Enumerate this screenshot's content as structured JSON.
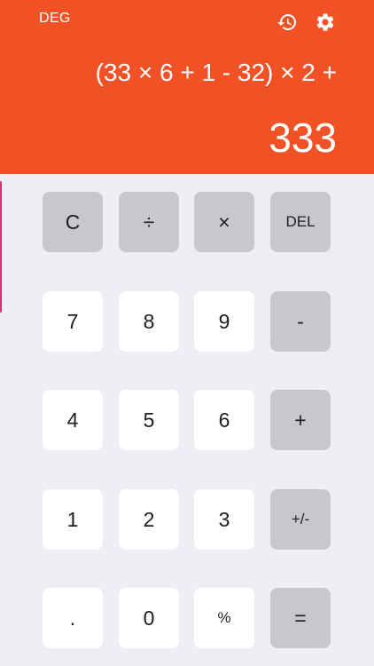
{
  "header": {
    "angle_mode": "DEG",
    "history_icon": "history-icon",
    "settings_icon": "gear-icon",
    "expression": "(33 × 6 + 1 - 32) × 2 +",
    "result": "333"
  },
  "colors": {
    "header_background": "#f05226",
    "keypad_background": "#efeef4",
    "number_key": "#ffffff",
    "operator_key": "#c8c7cd"
  },
  "keys": {
    "clear": "C",
    "divide": "÷",
    "multiply": "×",
    "delete": "DEL",
    "seven": "7",
    "eight": "8",
    "nine": "9",
    "minus": "-",
    "four": "4",
    "five": "5",
    "six": "6",
    "plus": "+",
    "one": "1",
    "two": "2",
    "three": "3",
    "negate": "+/-",
    "decimal": ".",
    "zero": "0",
    "percent": "%",
    "equals": "="
  }
}
